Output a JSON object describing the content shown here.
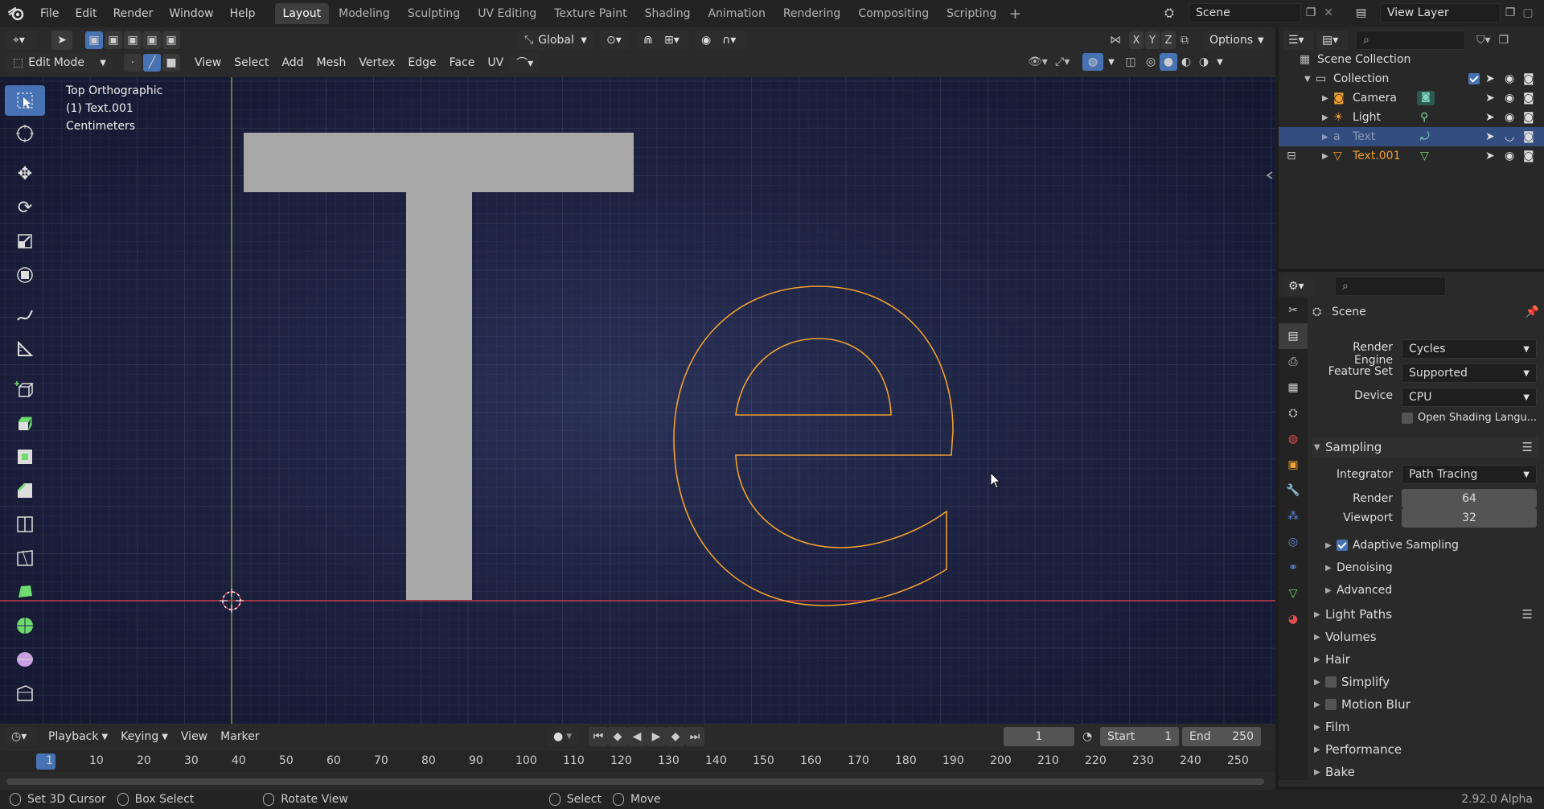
{
  "menu": [
    "File",
    "Edit",
    "Render",
    "Window",
    "Help"
  ],
  "workspaces": [
    {
      "label": "Layout",
      "active": true
    },
    {
      "label": "Modeling",
      "active": false
    },
    {
      "label": "Sculpting",
      "active": false
    },
    {
      "label": "UV Editing",
      "active": false
    },
    {
      "label": "Texture Paint",
      "active": false
    },
    {
      "label": "Shading",
      "active": false
    },
    {
      "label": "Animation",
      "active": false
    },
    {
      "label": "Rendering",
      "active": false
    },
    {
      "label": "Compositing",
      "active": false
    },
    {
      "label": "Scripting",
      "active": false
    }
  ],
  "scene_field": "Scene",
  "view_layer_field": "View Layer",
  "header": {
    "transform_orientation": "Global",
    "axes": [
      "X",
      "Y",
      "Z"
    ],
    "options_label": "Options",
    "mode": "Edit Mode",
    "menus": [
      "View",
      "Select",
      "Add",
      "Mesh",
      "Vertex",
      "Edge",
      "Face",
      "UV"
    ]
  },
  "viewport": {
    "view_name": "Top Orthographic",
    "object_label": "(1) Text.001",
    "units": "Centimeters",
    "glyph_t": "T",
    "glyph_e": "e"
  },
  "outliner": {
    "root": "Scene Collection",
    "collection": "Collection",
    "items": [
      {
        "name": "Camera",
        "icon": "camera-icon",
        "color": "#dddddd",
        "selected": false
      },
      {
        "name": "Light",
        "icon": "light-icon",
        "color": "#dddddd",
        "selected": false
      },
      {
        "name": "Text",
        "icon": "text-icon",
        "color": "#8a9ab8",
        "selected": true
      },
      {
        "name": "Text.001",
        "icon": "mesh-icon",
        "color": "#f0a030",
        "selected": false
      }
    ]
  },
  "properties": {
    "context": "Scene",
    "render_engine_label": "Render Engine",
    "render_engine": "Cycles",
    "feature_set_label": "Feature Set",
    "feature_set": "Supported",
    "device_label": "Device",
    "device": "CPU",
    "osl_label": "Open Shading Langu...",
    "sampling": "Sampling",
    "integrator_label": "Integrator",
    "integrator": "Path Tracing",
    "render_label": "Render",
    "render_samples": "64",
    "viewport_label": "Viewport",
    "viewport_samples": "32",
    "subpanels": [
      "Adaptive Sampling",
      "Denoising",
      "Advanced"
    ],
    "panels": [
      "Light Paths",
      "Volumes",
      "Hair",
      "Simplify",
      "Motion Blur",
      "Film",
      "Performance",
      "Bake"
    ]
  },
  "timeline": {
    "menus": [
      "Playback",
      "Keying",
      "View",
      "Marker"
    ],
    "current_frame": "1",
    "start_label": "Start",
    "start": "1",
    "end_label": "End",
    "end": "250",
    "ticks": [
      "1",
      "10",
      "20",
      "30",
      "40",
      "50",
      "60",
      "70",
      "80",
      "90",
      "100",
      "110",
      "120",
      "130",
      "140",
      "150",
      "160",
      "170",
      "180",
      "190",
      "200",
      "210",
      "220",
      "230",
      "240",
      "250"
    ]
  },
  "status": {
    "items": [
      "Set 3D Cursor",
      "Box Select",
      "Rotate View",
      "Select",
      "Move"
    ],
    "version": "2.92.0 Alpha"
  },
  "colors": {
    "accent": "#4772b3",
    "selection_orange": "#f0a030",
    "x_axis": "#c83c4a",
    "y_axis": "#7aa33a"
  }
}
